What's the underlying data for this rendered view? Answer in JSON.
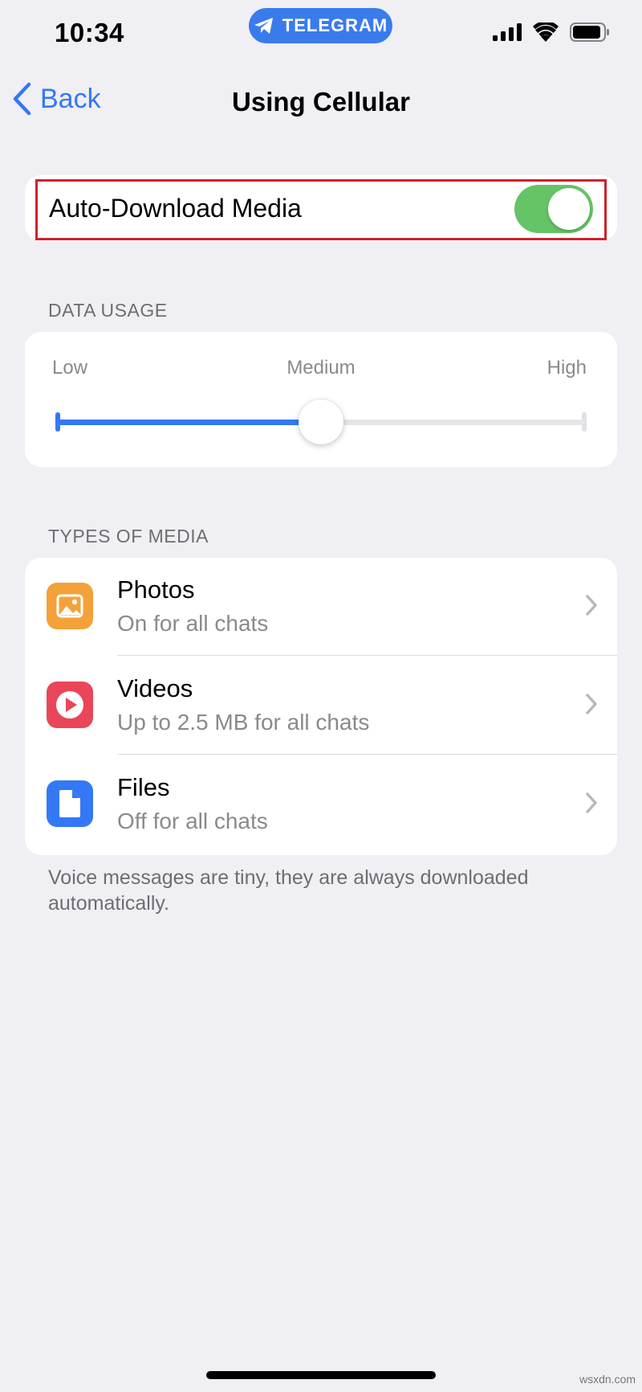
{
  "status_bar": {
    "time": "10:34",
    "app_pill": "TELEGRAM",
    "icons": [
      "cellular-signal-icon",
      "wifi-icon",
      "battery-icon"
    ]
  },
  "nav": {
    "back_label": "Back",
    "title": "Using Cellular"
  },
  "auto_download": {
    "label": "Auto-Download Media",
    "enabled": true,
    "highlighted": true
  },
  "data_usage": {
    "header": "DATA USAGE",
    "low_label": "Low",
    "medium_label": "Medium",
    "high_label": "High",
    "level": 0.5
  },
  "types_of_media": {
    "header": "TYPES OF MEDIA",
    "items": [
      {
        "title": "Photos",
        "subtitle": "On for all chats",
        "icon": "photo-icon",
        "color": "#f4a13a"
      },
      {
        "title": "Videos",
        "subtitle": "Up to 2.5 MB for all chats",
        "icon": "video-play-icon",
        "color": "#e9465a"
      },
      {
        "title": "Files",
        "subtitle": "Off for all chats",
        "icon": "file-icon",
        "color": "#3478f6"
      }
    ]
  },
  "footer_note": "Voice messages are tiny, they are always downloaded automatically.",
  "watermark": "wsxdn.com",
  "colors": {
    "accent": "#3478f6",
    "toggle_on": "#65c466",
    "highlight_border": "#d0202c",
    "background": "#efeff4"
  }
}
